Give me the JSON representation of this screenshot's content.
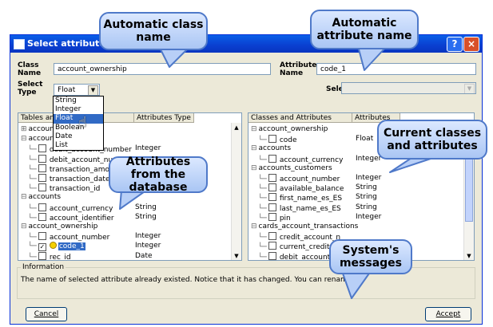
{
  "window": {
    "title": "Select attributes fro",
    "title_icon": "window-icon",
    "help_label": "?",
    "close_label": "×"
  },
  "form": {
    "class_name_label": "Class Name",
    "class_name_value": "account_ownership",
    "select_type_label": "Select Type",
    "select_type_value": "Float",
    "type_options": [
      "String",
      "Integer",
      "Float",
      "Boolean",
      "Date",
      "List"
    ],
    "selected_type_index": 2,
    "attribute_name_label": "Attribute Name",
    "attribute_name_value": "code_1",
    "select_list_type_label": "Select List Type",
    "select_list_type_value": ""
  },
  "left_panel": {
    "col1": "Tables an",
    "col2": "Attributes Type",
    "rows": [
      {
        "kind": "tree",
        "glyph": "+",
        "label": "accoun",
        "type": ""
      },
      {
        "kind": "tree",
        "glyph": "−",
        "label": "accour",
        "type": ""
      },
      {
        "kind": "leaf",
        "checked": false,
        "label": "debit_account_number",
        "type": "Integer"
      },
      {
        "kind": "leaf",
        "checked": false,
        "label": "debit_account_numb",
        "type": ""
      },
      {
        "kind": "leaf",
        "checked": false,
        "label": "transaction_amount",
        "type": ""
      },
      {
        "kind": "leaf",
        "checked": false,
        "label": "transaction_date",
        "type": ""
      },
      {
        "kind": "leaf",
        "checked": false,
        "label": "transaction_id",
        "type": ""
      },
      {
        "kind": "tree",
        "glyph": "−",
        "label": "accounts",
        "type": ""
      },
      {
        "kind": "leaf",
        "checked": false,
        "label": "account_currency",
        "type": "String"
      },
      {
        "kind": "leaf",
        "checked": false,
        "label": "account_identifier",
        "type": "String"
      },
      {
        "kind": "tree",
        "glyph": "−",
        "label": "account_ownership",
        "type": ""
      },
      {
        "kind": "leaf",
        "checked": false,
        "label": "account_number",
        "type": "Integer"
      },
      {
        "kind": "leaf",
        "checked": true,
        "key": true,
        "highlight": true,
        "label": "code_1",
        "type": "Integer"
      },
      {
        "kind": "leaf",
        "checked": false,
        "label": "rec_id",
        "type": "Date"
      }
    ]
  },
  "right_panel": {
    "col1": "Classes and Attributes",
    "col2": "Attributes",
    "rows": [
      {
        "kind": "tree",
        "glyph": "−",
        "label": "account_ownership",
        "type": ""
      },
      {
        "kind": "leaf",
        "checked": false,
        "label": "code",
        "type": "Float"
      },
      {
        "kind": "tree",
        "glyph": "−",
        "label": "accounts",
        "type": ""
      },
      {
        "kind": "leaf",
        "checked": false,
        "label": "account_currency",
        "type": "Integer"
      },
      {
        "kind": "tree",
        "glyph": "−",
        "label": "accounts_customers",
        "type": ""
      },
      {
        "kind": "leaf",
        "checked": false,
        "label": "account_number",
        "type": "Integer"
      },
      {
        "kind": "leaf",
        "checked": false,
        "label": "available_balance",
        "type": "String"
      },
      {
        "kind": "leaf",
        "checked": false,
        "label": "first_name_es_ES",
        "type": "String"
      },
      {
        "kind": "leaf",
        "checked": false,
        "label": "last_name_es_ES",
        "type": "String"
      },
      {
        "kind": "leaf",
        "checked": false,
        "label": "pin",
        "type": "Integer"
      },
      {
        "kind": "tree",
        "glyph": "−",
        "label": "cards_account_transactions",
        "type": ""
      },
      {
        "kind": "leaf",
        "checked": false,
        "label": "credit_account_n",
        "type": ""
      },
      {
        "kind": "leaf",
        "checked": false,
        "label": "current_credit_ba",
        "type": ""
      },
      {
        "kind": "leaf",
        "checked": false,
        "label": "debit_account_n",
        "type": ""
      }
    ]
  },
  "information": {
    "title": "Information",
    "message": "The name of selected attribute already existed. Notice that it has changed. You can rename it"
  },
  "buttons": {
    "cancel": "Cancel",
    "accept": "Accept"
  },
  "callouts": {
    "class_name": "Automatic class name",
    "attribute_name": "Automatic attribute name",
    "database": "Attributes from the database",
    "current": "Current classes and attributes",
    "messages": "System's messages"
  },
  "colors": {
    "titlebar": "#0a4fe0",
    "selection": "#316ac5",
    "callout_fill": "#c3d6fa",
    "callout_border": "#4f79c9"
  }
}
